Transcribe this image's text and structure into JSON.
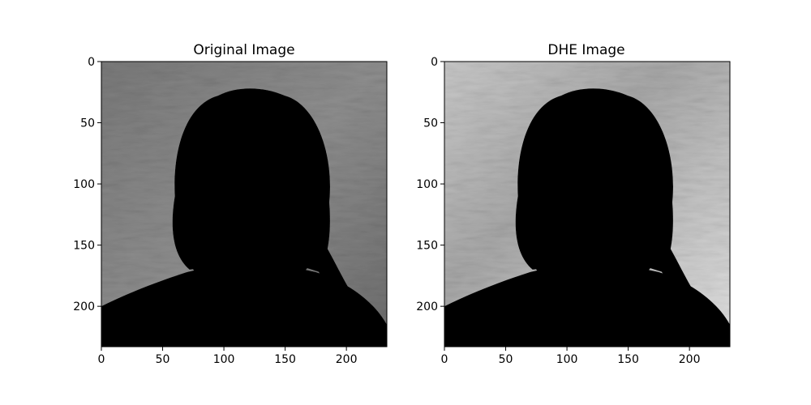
{
  "chart_data": [
    {
      "type": "image",
      "title": "Original Image",
      "image_description": "grayscale vintage portrait of a woman with dark hair and white collar, unenhanced",
      "xlim": [
        0,
        233
      ],
      "ylim": [
        233,
        0
      ],
      "xticks": [
        0,
        50,
        100,
        150,
        200
      ],
      "yticks": [
        0,
        50,
        100,
        150,
        200
      ],
      "xtick_labels": [
        "0",
        "50",
        "100",
        "150",
        "200"
      ],
      "ytick_labels": [
        "0",
        "50",
        "100",
        "150",
        "200"
      ],
      "tone": "mid-gray, low contrast"
    },
    {
      "type": "image",
      "title": "DHE Image",
      "image_description": "same grayscale portrait after dynamic histogram equalization, higher contrast with lighter background",
      "xlim": [
        0,
        233
      ],
      "ylim": [
        233,
        0
      ],
      "xticks": [
        0,
        50,
        100,
        150,
        200
      ],
      "yticks": [
        0,
        50,
        100,
        150,
        200
      ],
      "xtick_labels": [
        "0",
        "50",
        "100",
        "150",
        "200"
      ],
      "ytick_labels": [
        "0",
        "50",
        "100",
        "150",
        "200"
      ],
      "tone": "high contrast, light background"
    }
  ]
}
